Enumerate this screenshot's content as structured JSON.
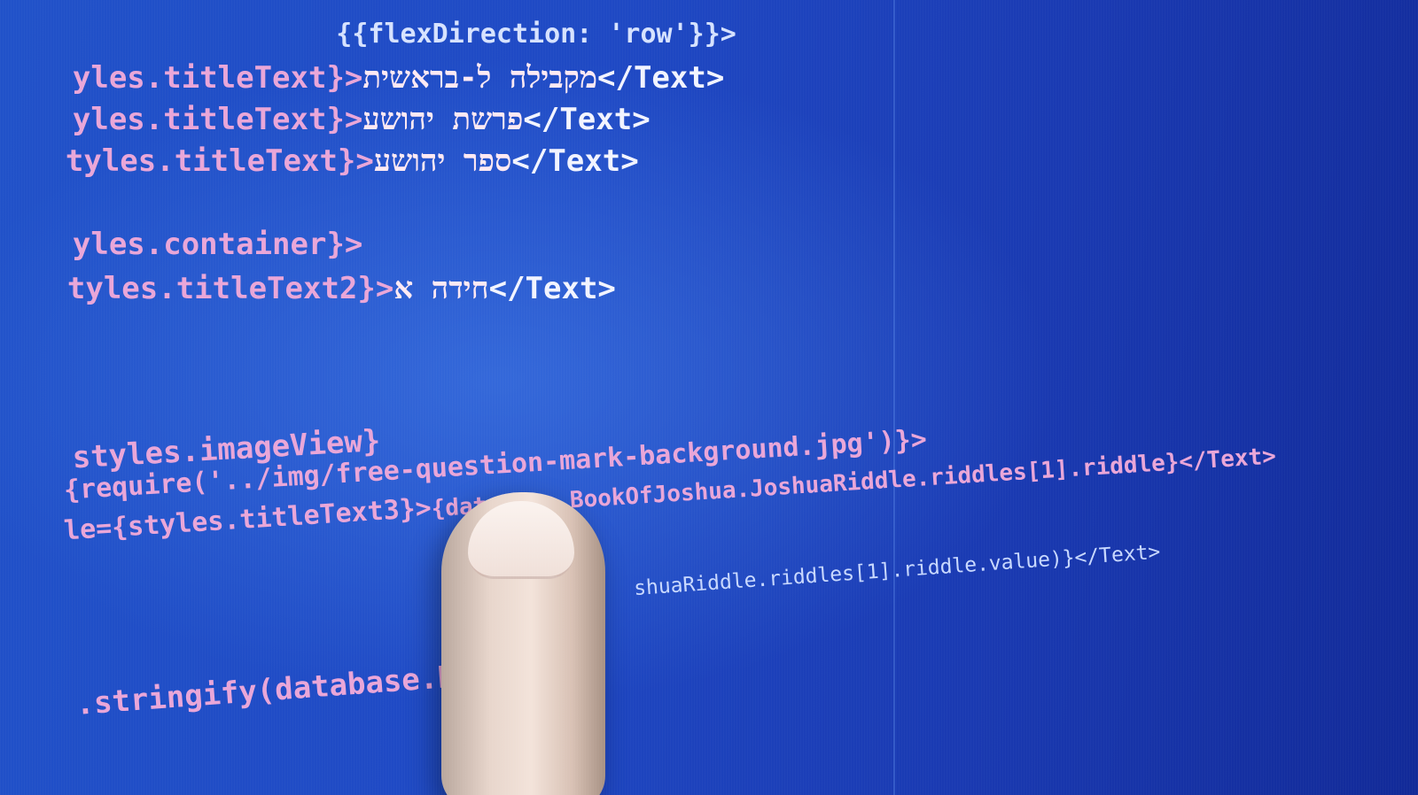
{
  "code": {
    "line0": "                 {{flexDirection: 'row'}}>",
    "line1_prefix": "yles.titleText}>",
    "line1_heb": "מקבילה ל-בראשית",
    "line1_suffix": "</Text>",
    "line2_prefix": "yles.titleText}>",
    "line2_heb": "פרשת יהושע",
    "line2_suffix": "</Text>",
    "line3_prefix": "tyles.titleText}>",
    "line3_heb": "ספר יהושע",
    "line3_suffix": "</Text>",
    "line4": "yles.container}>",
    "line5_prefix": "tyles.titleText2}>",
    "line5_heb": "חידה א",
    "line5_suffix": "</Text>",
    "line6": "styles.imageView}",
    "line7_a": "{require('../img/free-question-mark-background.jpg')}>",
    "line8_a": "{database.BookOfJoshua.JoshuaRiddle.riddles[1].riddle}</Text>",
    "line8_prefix": "le={styles.titleText3}>",
    "line9": "shuaRiddle.riddles[1].riddle.value)}</Text>",
    "line10": ".stringify(database.BookOf"
  },
  "colors": {
    "background": "#1f49c4",
    "keyword": "#e9a6d8",
    "tag": "#f2f4ff"
  }
}
